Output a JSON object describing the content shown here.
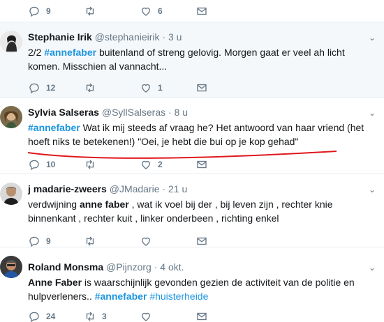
{
  "top_actions": {
    "reply_count": "9",
    "retweet_count": "",
    "like_count": "6"
  },
  "tweets": [
    {
      "name": "Stephanie Irik",
      "handle": "@stephanieirik",
      "dot": "·",
      "time": "3 u",
      "text_line1_pre": "2/2 ",
      "text_line1_tag": "#annefaber",
      "text_line1_post": " buitenland of streng gelovig.  Morgen gaat er veel ah licht",
      "text_line2": "komen.  Misschien al vannacht...",
      "reply_count": "12",
      "retweet_count": "",
      "like_count": "1"
    },
    {
      "name": "Sylvia Salseras",
      "handle": "@SyllSalseras",
      "dot": "·",
      "time": "8 u",
      "text_line1_tag": "#annefaber",
      "text_line1_post": " Wat ik mij steeds af vraag he? Het antwoord van haar vriend (het",
      "text_line2": "hoeft niks te betekenen!) \"Oei, je hebt die bui op je kop gehad\"",
      "reply_count": "10",
      "retweet_count": "",
      "like_count": "2"
    },
    {
      "name": "j madarie-zweers",
      "handle": "@JMadarie",
      "dot": "·",
      "time": "21 u",
      "text_line1_pre": "verdwijning ",
      "text_line1_bold": "anne faber",
      "text_line1_post": " , wat ik voel bij der , bij leven zijn , rechter knie",
      "text_line2": "binnenkant , rechter kuit , linker onderbeen , richting enkel",
      "reply_count": "9",
      "retweet_count": "",
      "like_count": ""
    },
    {
      "name": "Roland Monsma",
      "handle": "@Pijnzorg",
      "dot": "·",
      "time": "4 okt.",
      "text_line1_bold": "Anne Faber",
      "text_line1_post": " is waarschijnlijk gevonden gezien de activiteit van de politie en",
      "text_line2_pre": "hulpverleners.. ",
      "text_line2_tag1": "#annefaber",
      "text_line2_sp": " ",
      "text_line2_tag2": "#huisterheide",
      "reply_count": "24",
      "retweet_count": "3",
      "like_count": ""
    }
  ],
  "colors": {
    "accent": "#1b95e0",
    "muted": "#657786",
    "annotation": "#e0171c"
  },
  "icons": [
    "reply-icon",
    "retweet-icon",
    "like-icon",
    "message-icon",
    "chevron-down-icon"
  ]
}
